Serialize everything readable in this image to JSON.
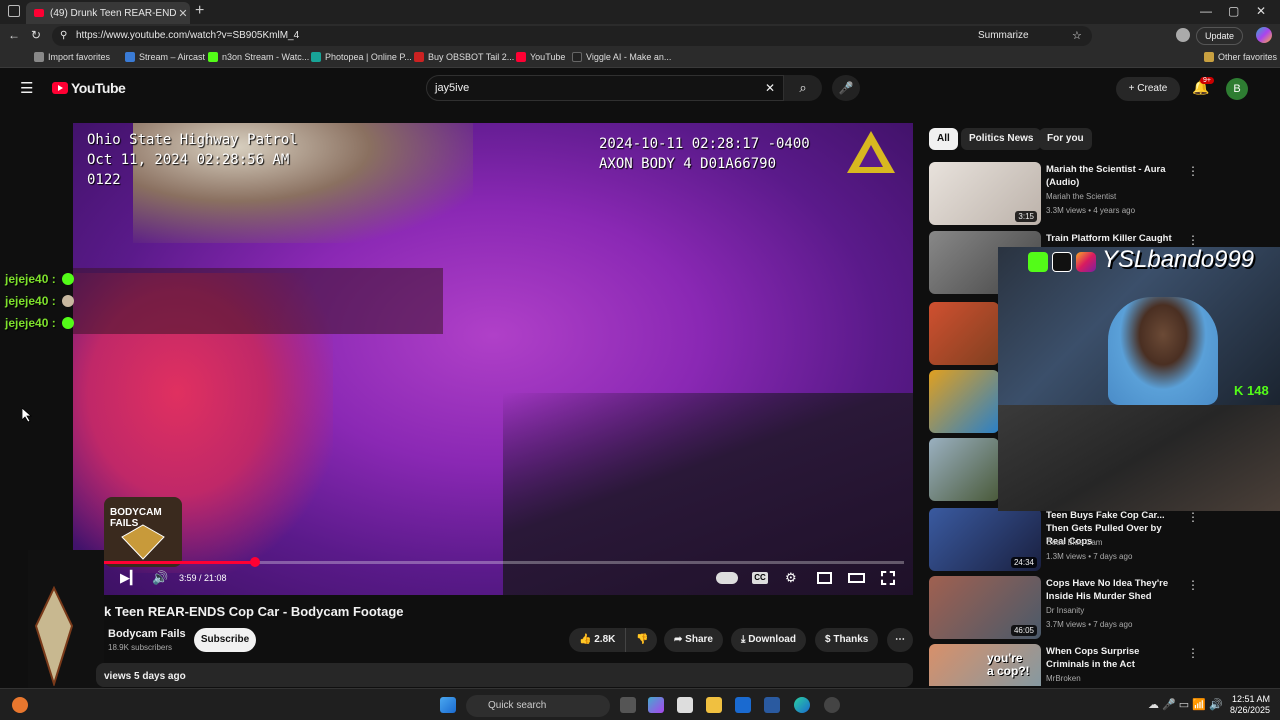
{
  "browser": {
    "tab_title": "(49) Drunk Teen REAR-ENDS",
    "tab_close": "✕",
    "new_tab": "+",
    "url": "https://www.youtube.com/watch?v=SB905KmlM_4",
    "summarize": "Summarize",
    "update": "Update",
    "window": {
      "min": "—",
      "max": "▢",
      "close": "✕"
    }
  },
  "bookmarks": [
    {
      "label": "Import favorites",
      "color": "#888888"
    },
    {
      "label": "Stream – Aircast",
      "color": "#3a7bd5"
    },
    {
      "label": "n3on Stream - Watc...",
      "color": "#53fc18"
    },
    {
      "label": "Photopea | Online P...",
      "color": "#18a497"
    },
    {
      "label": "Buy OBSBOT Tail 2...",
      "color": "#cc2222"
    },
    {
      "label": "YouTube",
      "color": "#ff0033"
    },
    {
      "label": "Viggle AI - Make an...",
      "color": "#222222"
    }
  ],
  "other_favorites": "Other favorites",
  "youtube": {
    "logo": "YouTube",
    "search_value": "jay5ive",
    "search_clear": "✕",
    "search_icon": "⌕",
    "mic_icon": "🎤",
    "create": "+ Create",
    "notif_count": "9+",
    "avatar_letter": "B"
  },
  "video": {
    "overlay_left": "Ohio State Highway Patrol\nOct 11, 2024 02:28:56 AM\n0122",
    "overlay_right": "2024-10-11 02:28:17 -0400\nAXON BODY 4 D01A66790",
    "time": "3:59 / 21:08",
    "progress": 0.189,
    "bodycam_logo": "BODYCAM FAILS"
  },
  "chat": [
    {
      "user": "jejeje40",
      "sep": ":"
    },
    {
      "user": "jejeje40",
      "sep": ":"
    },
    {
      "user": "jejeje40",
      "sep": ":"
    }
  ],
  "details": {
    "title": "k Teen REAR-ENDS Cop Car - Bodycam Footage",
    "channel": "Bodycam Fails",
    "subscribers": "18.9K subscribers",
    "subscribe": "Subscribe",
    "likes": "2.8K",
    "share": "Share",
    "download": "Download",
    "thanks": "Thanks",
    "more": "⋯",
    "views_age": "views  5 days ago"
  },
  "chips": [
    "All",
    "Politics News",
    "For you"
  ],
  "recommendations": [
    {
      "title": "Mariah the Scientist - Aura (Audio)",
      "channel": "Mariah the Scientist",
      "meta": "3.3M views • 4 years ago",
      "duration": "3:15",
      "thumb": "#d9d2cc"
    },
    {
      "title": "Train Platform Killer Caught on",
      "channel": "",
      "meta": "",
      "duration": "",
      "thumb": "#6c6c6c"
    },
    {
      "title": "",
      "channel": "",
      "meta": "",
      "duration": "",
      "thumb": "#c04828"
    },
    {
      "title": "",
      "channel": "",
      "meta": "",
      "duration": "",
      "thumb": "#3a8ac8"
    },
    {
      "title": "",
      "channel": "",
      "meta": "",
      "duration": "",
      "thumb": "#6a7a4a"
    },
    {
      "title": "Teen Buys Fake Cop Car... Then Gets Pulled Over by Real Cops",
      "channel": "Code Blue Cam",
      "meta": "1.3M views • 7 days ago",
      "duration": "24:34",
      "thumb": "#2a3a6a"
    },
    {
      "title": "Cops Have No Idea They're Inside His Murder Shed",
      "channel": "Dr Insanity",
      "meta": "3.7M views • 7 days ago",
      "duration": "46:05",
      "thumb": "#8a5a48"
    },
    {
      "title": "When Cops Surprise Criminals in the Act",
      "channel": "MrBroken",
      "meta": "",
      "duration": "",
      "thumb": "#c87a5a"
    }
  ],
  "stream": {
    "handle": "YSLbando999",
    "viewers": "148"
  },
  "taskbar": {
    "search": "Quick search",
    "time": "12:51 AM",
    "date": "8/26/2025"
  }
}
